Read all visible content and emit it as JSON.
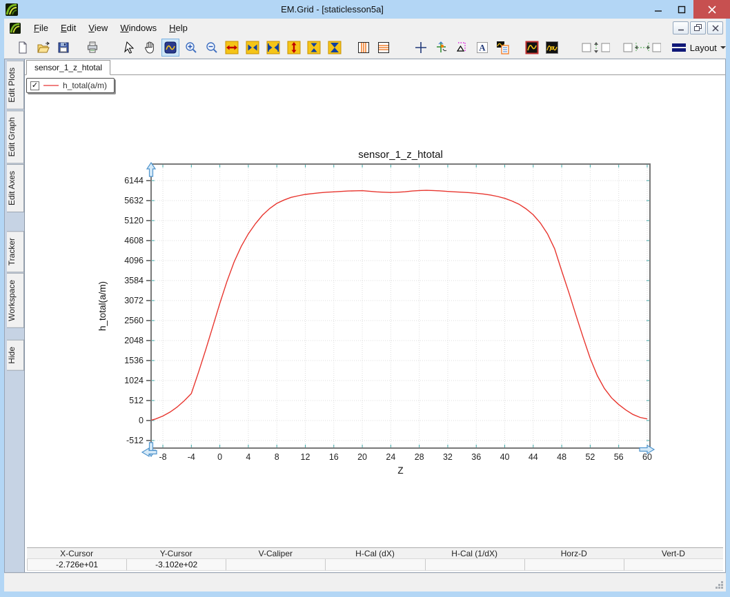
{
  "window": {
    "title": "EM.Grid - [staticlesson5a]"
  },
  "menu": {
    "items": [
      {
        "label": "File"
      },
      {
        "label": "Edit"
      },
      {
        "label": "View"
      },
      {
        "label": "Windows"
      },
      {
        "label": "Help"
      }
    ]
  },
  "toolbar": {
    "layout_label": "Layout",
    "icons": [
      "new-document",
      "open-file",
      "save",
      "print",
      "select-arrow",
      "pan-hand",
      "zoom-box",
      "zoom-in",
      "zoom-out",
      "expand-x",
      "scroll-x",
      "compress-x",
      "expand-y",
      "scroll-y",
      "compress-y",
      "vertical-markers",
      "horizontal-markers",
      "cross-cursor",
      "tracker",
      "caliper",
      "add-text",
      "legend",
      "single-plot-window",
      "multi-plot-window",
      "align-vertical",
      "align-horizontal",
      "layout-menu"
    ],
    "selected_icon": "zoom-box"
  },
  "sidebar": {
    "items": [
      {
        "label": "Edit Plots",
        "gap_before": 0
      },
      {
        "label": "Edit Graph",
        "gap_before": 0
      },
      {
        "label": "Edit Axes",
        "gap_before": 0
      },
      {
        "label": "Tracker",
        "gap_before": 26
      },
      {
        "label": "Workspace",
        "gap_before": 0
      },
      {
        "label": "Hide",
        "gap_before": 16
      }
    ]
  },
  "tabs": [
    {
      "label": "sensor_1_z_htotal",
      "active": true
    }
  ],
  "legend": {
    "checked": true,
    "label": "h_total(a/m)",
    "line_color": "#f08080"
  },
  "chart_data": {
    "type": "line",
    "title": "sensor_1_z_htotal",
    "xlabel": "Z",
    "ylabel": "h_total(a/m)",
    "xlim": [
      -9.65,
      60.39
    ],
    "ylim": [
      -706,
      6567
    ],
    "x_ticks": [
      -8,
      -4,
      0,
      4,
      8,
      12,
      16,
      20,
      24,
      28,
      32,
      36,
      40,
      44,
      48,
      52,
      56,
      60
    ],
    "y_ticks": [
      -512,
      0,
      512,
      1024,
      1536,
      2048,
      2560,
      3072,
      3584,
      4096,
      4608,
      5120,
      5632,
      6144
    ],
    "grid": true,
    "legend_position": "top-left overlay",
    "series": [
      {
        "name": "h_total(a/m)",
        "color": "#e8352e",
        "points": [
          [
            -9.6,
            10
          ],
          [
            -9,
            40
          ],
          [
            -8,
            115
          ],
          [
            -7,
            215
          ],
          [
            -6,
            345
          ],
          [
            -5,
            505
          ],
          [
            -4,
            690
          ],
          [
            -3,
            1230
          ],
          [
            -2,
            1805
          ],
          [
            -1,
            2400
          ],
          [
            0,
            3000
          ],
          [
            1,
            3560
          ],
          [
            2,
            4060
          ],
          [
            3,
            4460
          ],
          [
            4,
            4780
          ],
          [
            5,
            5040
          ],
          [
            6,
            5260
          ],
          [
            7,
            5430
          ],
          [
            8,
            5560
          ],
          [
            9,
            5645
          ],
          [
            10,
            5715
          ],
          [
            11,
            5755
          ],
          [
            12,
            5790
          ],
          [
            13,
            5812
          ],
          [
            14,
            5830
          ],
          [
            15,
            5846
          ],
          [
            16,
            5856
          ],
          [
            17,
            5866
          ],
          [
            18,
            5876
          ],
          [
            19,
            5882
          ],
          [
            20,
            5886
          ],
          [
            21,
            5872
          ],
          [
            22,
            5856
          ],
          [
            23,
            5846
          ],
          [
            24,
            5840
          ],
          [
            25,
            5846
          ],
          [
            26,
            5858
          ],
          [
            27,
            5876
          ],
          [
            28,
            5890
          ],
          [
            29,
            5894
          ],
          [
            30,
            5890
          ],
          [
            31,
            5880
          ],
          [
            32,
            5866
          ],
          [
            33,
            5856
          ],
          [
            34,
            5846
          ],
          [
            35,
            5836
          ],
          [
            36,
            5820
          ],
          [
            37,
            5800
          ],
          [
            38,
            5774
          ],
          [
            39,
            5738
          ],
          [
            40,
            5690
          ],
          [
            41,
            5622
          ],
          [
            42,
            5540
          ],
          [
            43,
            5420
          ],
          [
            44,
            5270
          ],
          [
            45,
            5060
          ],
          [
            46,
            4780
          ],
          [
            47,
            4400
          ],
          [
            48,
            3830
          ],
          [
            49,
            3280
          ],
          [
            50,
            2700
          ],
          [
            51,
            2130
          ],
          [
            52,
            1590
          ],
          [
            53,
            1150
          ],
          [
            54,
            820
          ],
          [
            55,
            580
          ],
          [
            56,
            410
          ],
          [
            57,
            270
          ],
          [
            58,
            155
          ],
          [
            59,
            80
          ],
          [
            60,
            40
          ]
        ]
      }
    ]
  },
  "status_table": {
    "columns": [
      {
        "label": "X-Cursor",
        "value": "-2.726e+01"
      },
      {
        "label": "Y-Cursor",
        "value": "-3.102e+02"
      },
      {
        "label": "V-Caliper",
        "value": ""
      },
      {
        "label": "H-Cal (dX)",
        "value": ""
      },
      {
        "label": "H-Cal (1/dX)",
        "value": ""
      },
      {
        "label": "Horz-D",
        "value": ""
      },
      {
        "label": "Vert-D",
        "value": ""
      }
    ]
  },
  "colors": {
    "titlebar": "#b3d6f5",
    "close_button": "#c75050",
    "series_red": "#e8352e",
    "legend_line": "#f08080",
    "selected_tool_bg": "#cde6f7",
    "handle_blue": "#4f94cd",
    "grid_line": "#dcdcdc",
    "tick_teal": "#3aa6a6"
  }
}
